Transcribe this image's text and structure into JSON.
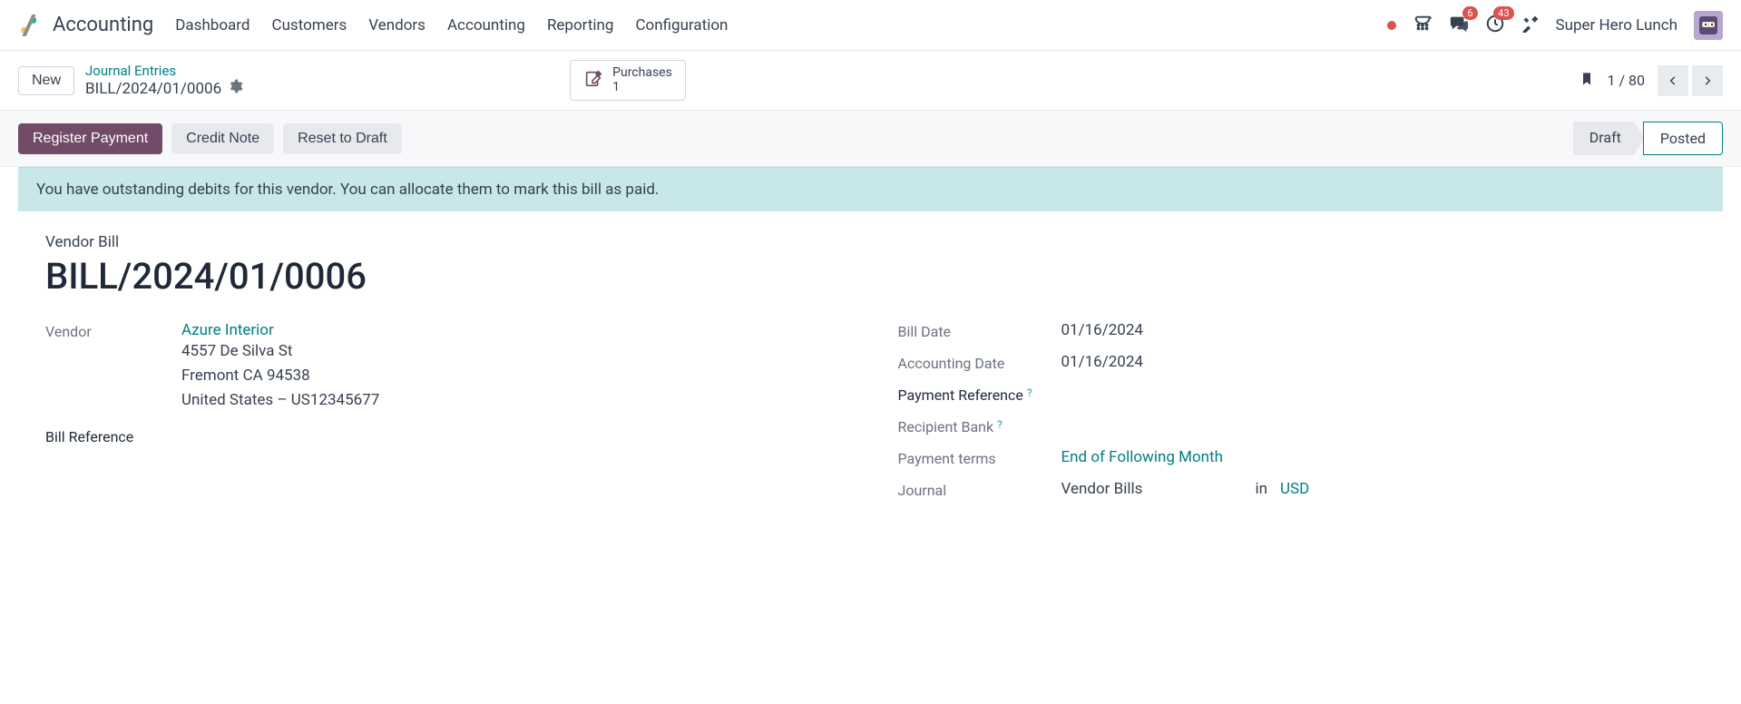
{
  "topbar": {
    "app_title": "Accounting",
    "nav": [
      "Dashboard",
      "Customers",
      "Vendors",
      "Accounting",
      "Reporting",
      "Configuration"
    ],
    "chat_badge": "6",
    "activity_badge": "43",
    "user_name": "Super Hero Lunch"
  },
  "subbar": {
    "new_label": "New",
    "breadcrumb_parent": "Journal Entries",
    "breadcrumb_current": "BILL/2024/01/0006",
    "smart_label": "Purchases",
    "smart_count": "1",
    "pager": "1 / 80"
  },
  "actionbar": {
    "register_payment": "Register Payment",
    "credit_note": "Credit Note",
    "reset_draft": "Reset to Draft",
    "status_draft": "Draft",
    "status_posted": "Posted"
  },
  "notice": "You have outstanding debits for this vendor. You can allocate them to mark this bill as paid.",
  "form": {
    "doc_label": "Vendor Bill",
    "doc_title": "BILL/2024/01/0006",
    "left": {
      "vendor_label": "Vendor",
      "vendor_name": "Azure Interior",
      "vendor_street": "4557 De Silva St",
      "vendor_city": "Fremont CA 94538",
      "vendor_country": "United States – US12345677",
      "bill_ref_label": "Bill Reference"
    },
    "right": {
      "bill_date_label": "Bill Date",
      "bill_date": "01/16/2024",
      "acc_date_label": "Accounting Date",
      "acc_date": "01/16/2024",
      "pay_ref_label": "Payment Reference",
      "recip_bank_label": "Recipient Bank",
      "pay_terms_label": "Payment terms",
      "pay_terms": "End of Following Month",
      "journal_label": "Journal",
      "journal": "Vendor Bills",
      "in_label": "in",
      "currency": "USD"
    }
  }
}
